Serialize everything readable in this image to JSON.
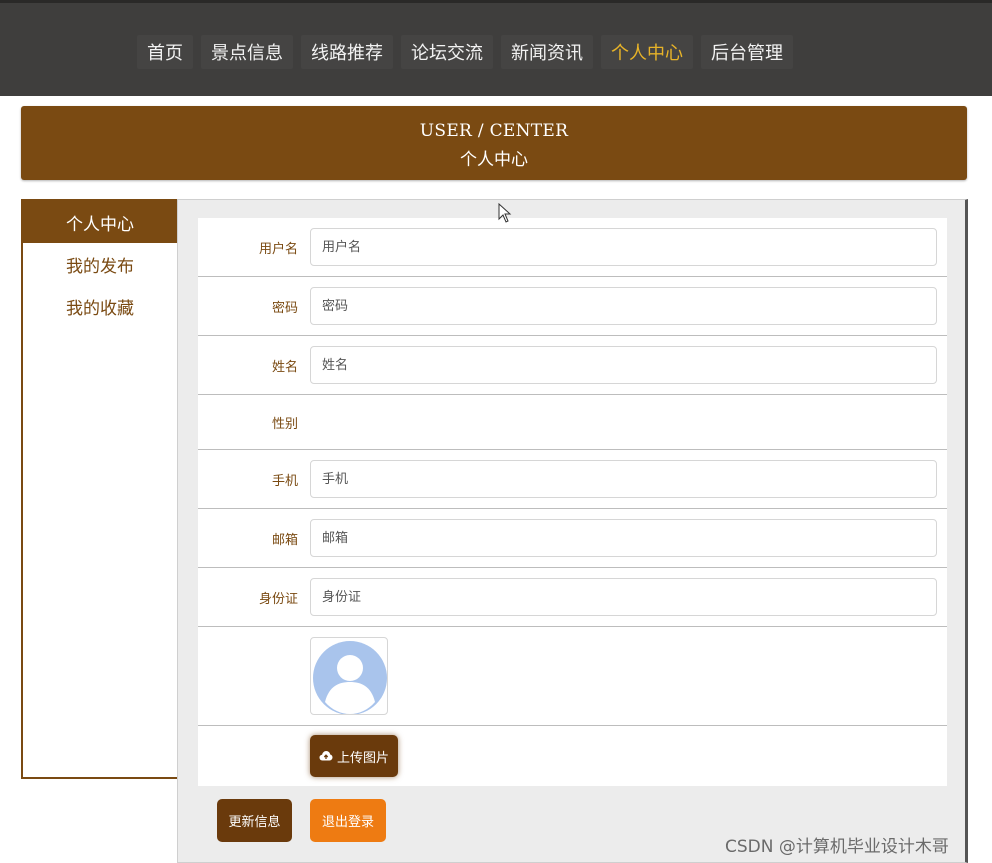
{
  "nav": {
    "items": [
      {
        "label": "首页"
      },
      {
        "label": "景点信息"
      },
      {
        "label": "线路推荐"
      },
      {
        "label": "论坛交流"
      },
      {
        "label": "新闻资讯"
      },
      {
        "label": "个人中心",
        "active": true
      },
      {
        "label": "后台管理"
      }
    ]
  },
  "banner": {
    "title_en": "USER / CENTER",
    "title_cn": "个人中心"
  },
  "sidebar": {
    "items": [
      {
        "label": "个人中心",
        "active": true
      },
      {
        "label": "我的发布"
      },
      {
        "label": "我的收藏"
      }
    ]
  },
  "form": {
    "username": {
      "label": "用户名",
      "placeholder": "用户名",
      "value": ""
    },
    "password": {
      "label": "密码",
      "placeholder": "密码",
      "value": ""
    },
    "name": {
      "label": "姓名",
      "placeholder": "姓名",
      "value": ""
    },
    "gender": {
      "label": "性别",
      "value": ""
    },
    "phone": {
      "label": "手机",
      "placeholder": "手机",
      "value": ""
    },
    "email": {
      "label": "邮箱",
      "placeholder": "邮箱",
      "value": ""
    },
    "idcard": {
      "label": "身份证",
      "placeholder": "身份证",
      "value": ""
    },
    "avatar": {
      "icon": "default-avatar-icon"
    },
    "upload_label": "上传图片",
    "upload_icon": "cloud-upload-icon"
  },
  "actions": {
    "update_label": "更新信息",
    "logout_label": "退出登录"
  },
  "watermark": "CSDN @计算机毕业设计木哥",
  "colors": {
    "nav_bg": "#3f3e3d",
    "nav_active": "#e7b328",
    "brand_brown": "#7a4a12",
    "button_dark": "#6a3a0c",
    "button_orange": "#ee7b12",
    "avatar_blue": "#a9c4ec"
  }
}
